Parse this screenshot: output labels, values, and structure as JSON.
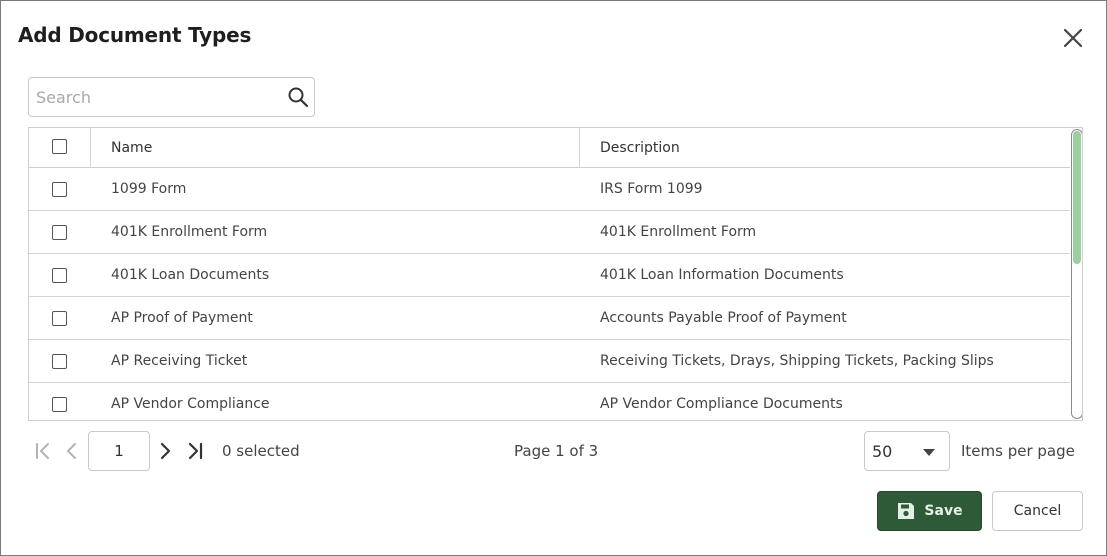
{
  "dialog": {
    "title": "Add Document Types",
    "close_icon": "close-icon"
  },
  "search": {
    "placeholder": "Search",
    "value": "",
    "icon": "search-icon"
  },
  "table": {
    "columns": [
      "Name",
      "Description"
    ],
    "rows": [
      {
        "name": "1099 Form",
        "description": "IRS Form 1099",
        "checked": false
      },
      {
        "name": "401K Enrollment Form",
        "description": "401K Enrollment Form",
        "checked": false
      },
      {
        "name": "401K Loan Documents",
        "description": "401K Loan Information Documents",
        "checked": false
      },
      {
        "name": "AP Proof of Payment",
        "description": "Accounts Payable Proof of Payment",
        "checked": false
      },
      {
        "name": "AP Receiving Ticket",
        "description": "Receiving Tickets, Drays, Shipping Tickets, Packing Slips",
        "checked": false
      },
      {
        "name": "AP Vendor Compliance",
        "description": "AP Vendor Compliance Documents",
        "checked": false
      }
    ]
  },
  "pager": {
    "current_page": "1",
    "selected_text": "0 selected",
    "page_info": "Page 1 of 3",
    "items_per_page_value": "50",
    "items_per_page_label": "Items per page"
  },
  "actions": {
    "save_label": "Save",
    "cancel_label": "Cancel"
  },
  "colors": {
    "primary_button": "#2e5a38",
    "scroll_thumb": "#9ccf9f",
    "border": "#cfcfcf"
  }
}
